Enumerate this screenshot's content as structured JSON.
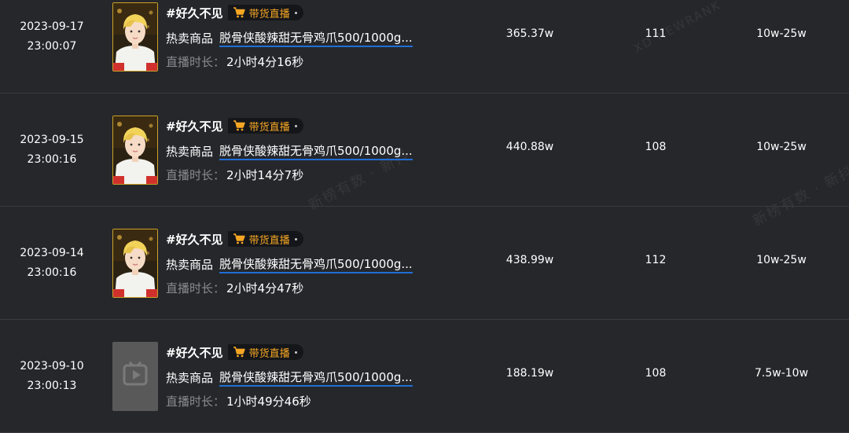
{
  "rows": [
    {
      "date": "2023-09-17",
      "time": "23:00:07",
      "title": "#好久不见",
      "badge": "带货直播",
      "product_label": "热卖商品",
      "product_name": "脱骨侠酸辣甜无骨鸡爪500/1000g...",
      "duration_label": "直播时长：",
      "duration": "2小时4分16秒",
      "views": "365.37w",
      "count": "111",
      "range": "10w-25w",
      "thumb": "avatar"
    },
    {
      "date": "2023-09-15",
      "time": "23:00:16",
      "title": "#好久不见",
      "badge": "带货直播",
      "product_label": "热卖商品",
      "product_name": "脱骨侠酸辣甜无骨鸡爪500/1000g...",
      "duration_label": "直播时长：",
      "duration": "2小时14分7秒",
      "views": "440.88w",
      "count": "108",
      "range": "10w-25w",
      "thumb": "avatar"
    },
    {
      "date": "2023-09-14",
      "time": "23:00:16",
      "title": "#好久不见",
      "badge": "带货直播",
      "product_label": "热卖商品",
      "product_name": "脱骨侠酸辣甜无骨鸡爪500/1000g...",
      "duration_label": "直播时长：",
      "duration": "2小时4分47秒",
      "views": "438.99w",
      "count": "112",
      "range": "10w-25w",
      "thumb": "avatar"
    },
    {
      "date": "2023-09-10",
      "time": "23:00:13",
      "title": "#好久不见",
      "badge": "带货直播",
      "product_label": "热卖商品",
      "product_name": "脱骨侠酸辣甜无骨鸡爪500/1000g...",
      "duration_label": "直播时长：",
      "duration": "1小时49分46秒",
      "views": "188.19w",
      "count": "108",
      "range": "7.5w-10w",
      "thumb": "placeholder"
    }
  ],
  "watermarks": {
    "a": "新榜有数 · 新抖",
    "b": "新榜有数 · 新抖",
    "c": "XD NEWRANK"
  },
  "colors": {
    "background": "#26272b",
    "badge_text": "#f5a623",
    "link_underline": "#1f6fd6",
    "thumb_border": "#c9a227"
  },
  "icons": {
    "badge": "cart-icon",
    "placeholder": "play-icon"
  }
}
